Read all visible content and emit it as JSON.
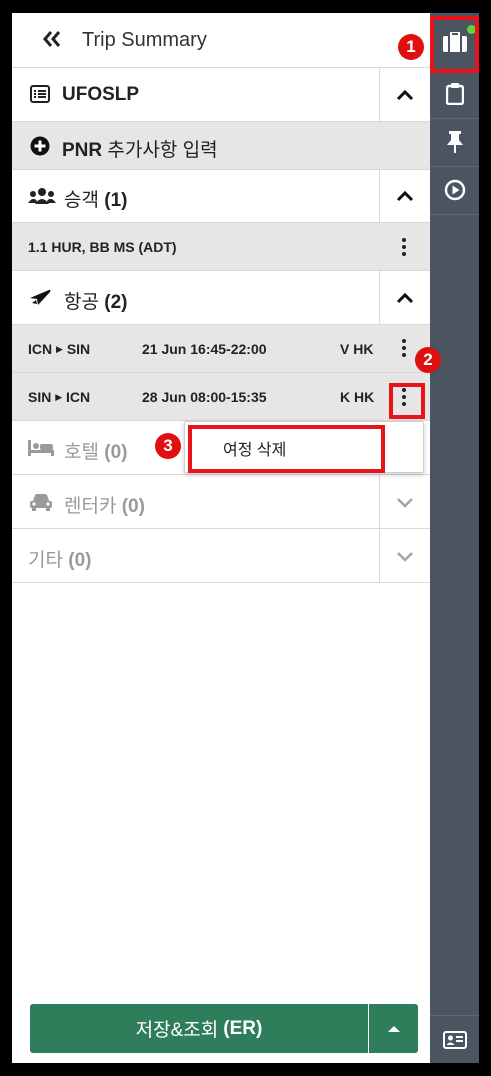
{
  "header": {
    "title": "Trip Summary"
  },
  "pnr": {
    "code": "UFOSLP",
    "add_label_bold": "PNR",
    "add_label": "추가사항 입력"
  },
  "passengers": {
    "label": "승객",
    "count": "(1)",
    "item": "1.1 HUR, BB MS (ADT)"
  },
  "air": {
    "label": "항공",
    "count": "(2)",
    "segments": [
      {
        "route_from": "ICN",
        "route_to": "SIN",
        "datetime": "21 Jun 16:45-22:00",
        "status": "V HK"
      },
      {
        "route_from": "SIN",
        "route_to": "ICN",
        "datetime": "28 Jun 08:00-15:35",
        "status": "K HK"
      }
    ]
  },
  "hotel": {
    "label": "호텔",
    "count": "(0)"
  },
  "car": {
    "label": "렌터카",
    "count": "(0)"
  },
  "other": {
    "label": "기타",
    "count": "(0)"
  },
  "context_menu": {
    "delete_segment": "여정 삭제"
  },
  "footer": {
    "save_label": "저장&조회",
    "save_code": "(ER)"
  },
  "callouts": {
    "one": "1",
    "two": "2",
    "three": "3"
  },
  "colors": {
    "accent_green": "#2e7d5b",
    "rail": "#4a5561",
    "highlight_red": "#e8141a"
  }
}
